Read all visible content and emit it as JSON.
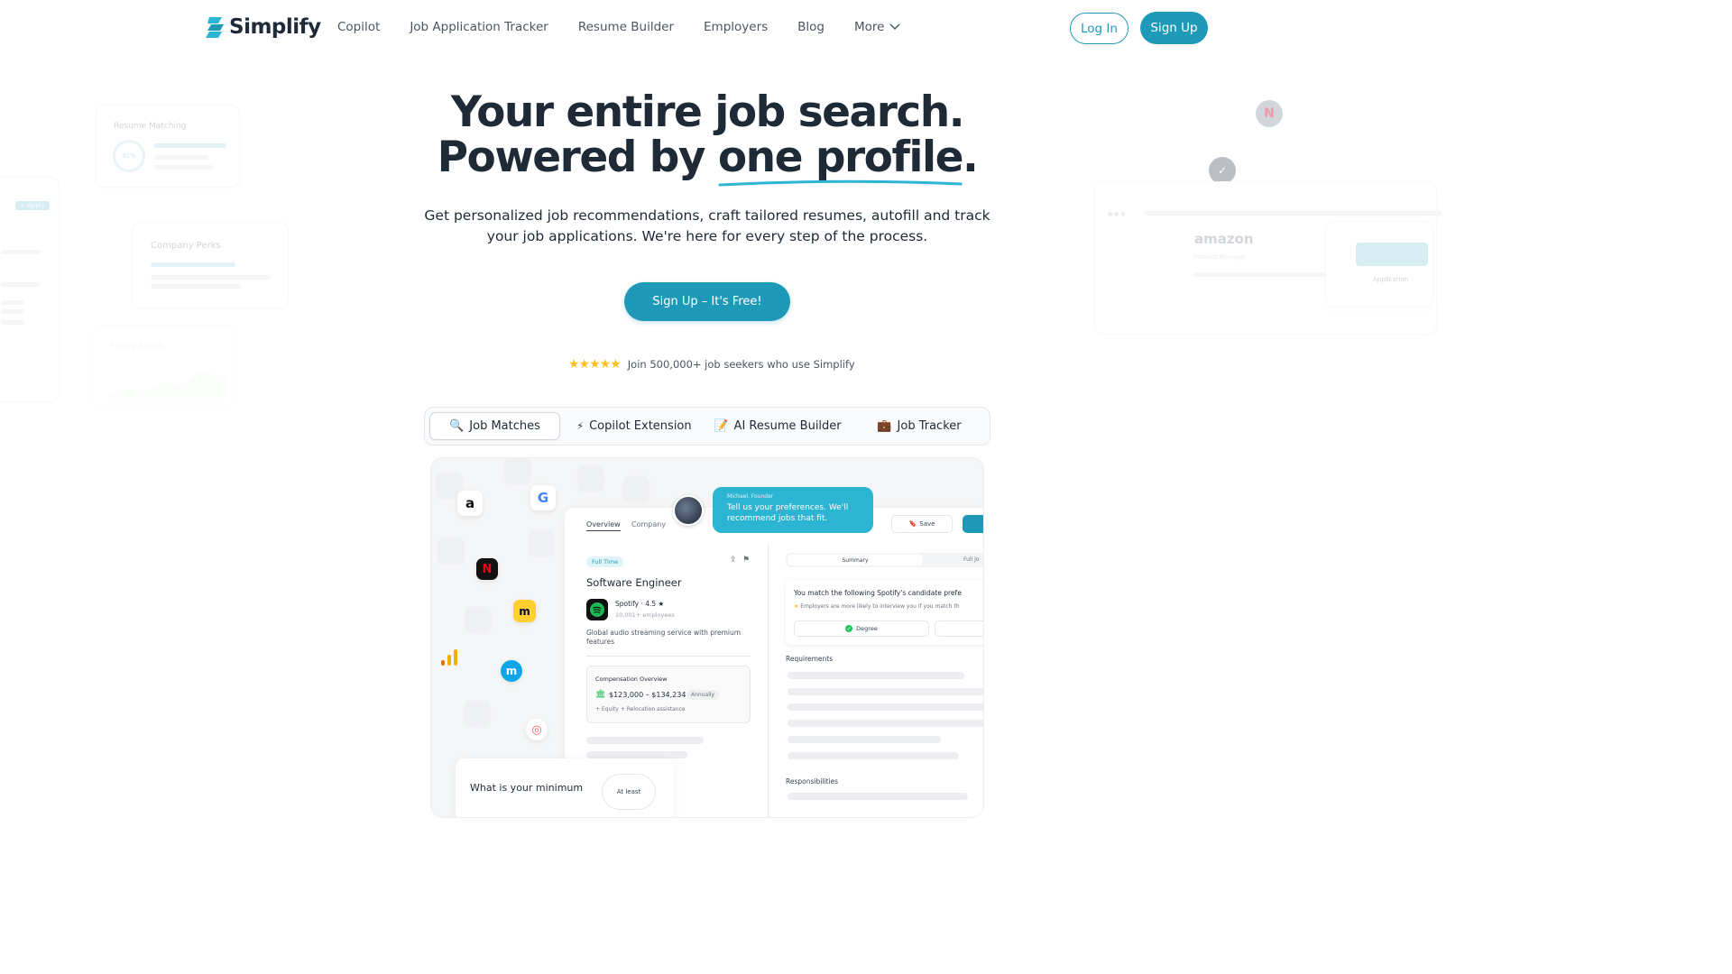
{
  "nav": {
    "logo": "Simplify",
    "links": [
      "Copilot",
      "Job Application Tracker",
      "Resume Builder",
      "Employers",
      "Blog",
      "More"
    ],
    "login": "Log In",
    "signup": "Sign Up"
  },
  "hero": {
    "line1": "Your entire job search.",
    "line2_prefix": "Powered by ",
    "line2_highlight": "one profile",
    "line2_suffix": ".",
    "subtitle": "Get personalized job recommendations, craft tailored resumes, autofill and track your job applications. We're here for every step of the process.",
    "cta": "Sign Up – It's Free!",
    "social_proof": "Join 500,000+ job seekers who use Simplify",
    "rating_stars": 5
  },
  "tabs": [
    {
      "icon": "🔍",
      "label": "Job Matches",
      "active": true
    },
    {
      "icon": "⚡",
      "label": "Copilot Extension",
      "active": false
    },
    {
      "icon": "📝",
      "label": "AI Resume Builder",
      "active": false
    },
    {
      "icon": "💼",
      "label": "Job Tracker",
      "active": false
    }
  ],
  "preview": {
    "tab_overview": "Overview",
    "tab_company": "Company",
    "badge": "Full Time",
    "job_title": "Software Engineer",
    "company": "Spotify · 4.5 ★",
    "employees": "10,001+ employees",
    "description": "Global audio streaming service with premium features",
    "comp_title": "Compensation Overview",
    "salary": "$123,000 – $134,234",
    "salary_period": "Annually",
    "benefits": "+ Equity + Relocation assistance",
    "chat_sender": "Michael, Founder",
    "chat_message": "Tell us your preferences. We'll recommend jobs that fit.",
    "save": "Save",
    "summary": "Summary",
    "full_job": "Full Jo",
    "match_title": "You match the following Spotify's candidate prefe",
    "match_sub": "Employers are more likely to interview you if you match th",
    "degree": "Degree",
    "requirements": "Requirements",
    "responsibilities": "Responsibilities",
    "min_question": "What is your minimum",
    "at_least": "At least"
  },
  "decor": {
    "resume_matching": "Resume Matching",
    "match_pct": "92%",
    "apply": "+ Apply",
    "company_perks": "Company Perks",
    "hiring_trends": "Hiring Trends",
    "amazon": "amazon",
    "product_manager": "Product Manager",
    "application": "Application"
  },
  "colors": {
    "brand": "#1e9ab8",
    "chat_bubble": "#2bb5d2",
    "star": "#fbbf24"
  }
}
